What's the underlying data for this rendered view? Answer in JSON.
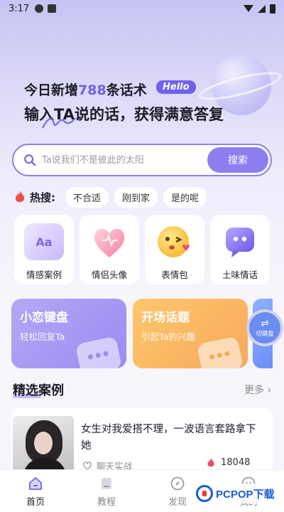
{
  "status_bar": {
    "time": "3:17"
  },
  "hero": {
    "line1_prefix": "今日新增",
    "line1_number": "788",
    "line1_suffix": "条话术",
    "badge": "Hello",
    "line2": "输入TA说的话，获得满意答复"
  },
  "search": {
    "placeholder": "Ta说我们不是彼此的太阳",
    "button_label": "搜索"
  },
  "hot": {
    "label": "热搜:",
    "chips": [
      "不合适",
      "刚到家",
      "是的呢"
    ]
  },
  "categories": [
    {
      "label": "情感案例",
      "icon": "aa-book-icon"
    },
    {
      "label": "情侣头像",
      "icon": "heart-icon"
    },
    {
      "label": "表情包",
      "icon": "emoji-icon"
    },
    {
      "label": "土味情话",
      "icon": "chat-bubble-icon"
    }
  ],
  "features": [
    {
      "title": "小恋键盘",
      "subtitle": "轻松回复Ta",
      "color": "#9b8bf2"
    },
    {
      "title": "开场话题",
      "subtitle": "引起Ta的兴趣",
      "color": "#f8a85b"
    }
  ],
  "keyboard_switch": {
    "arrow": "⇌",
    "label": "切键盘"
  },
  "section": {
    "title": "精选案例",
    "more": "更多 ›"
  },
  "case": {
    "title": "女生对我爱搭不理，一波语言套路拿下她",
    "tag": "聊天实战",
    "count": "18048"
  },
  "tabs": [
    {
      "label": "首页",
      "active": true
    },
    {
      "label": "教程",
      "active": false
    },
    {
      "label": "发现",
      "active": false
    },
    {
      "label": "我的",
      "active": false
    }
  ],
  "watermark": {
    "text": "PCPOP下载"
  },
  "colors": {
    "accent": "#8b7ff0",
    "accent_dark": "#6b61e6",
    "orange": "#f8a85b",
    "blue": "#6b8cf0"
  }
}
